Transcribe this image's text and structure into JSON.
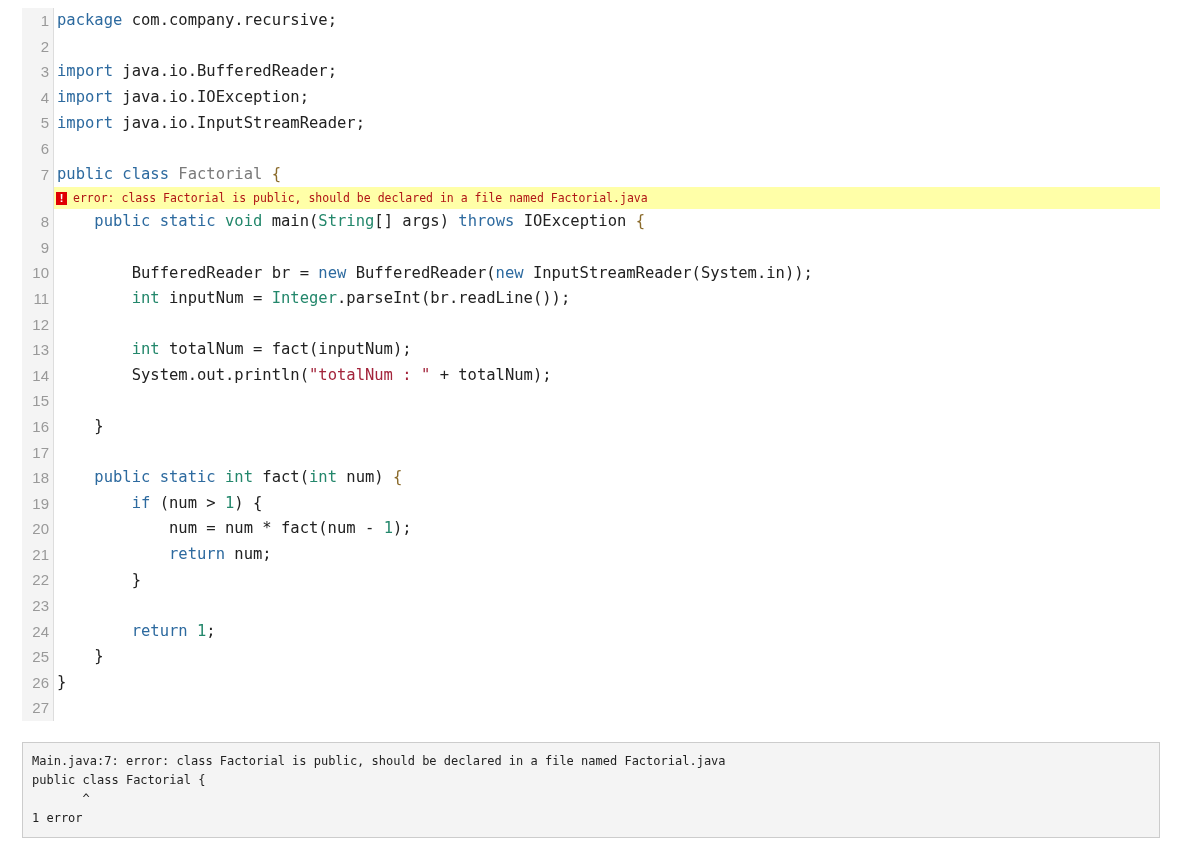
{
  "editor": {
    "lines": [
      {
        "kind": "code",
        "number": "1",
        "tokens": [
          {
            "kind": "keyword",
            "text": "package"
          },
          {
            "kind": "plain",
            "text": " com.company.recursive;"
          }
        ]
      },
      {
        "kind": "code",
        "number": "2"
      },
      {
        "kind": "code",
        "number": "3",
        "tokens": [
          {
            "kind": "keyword",
            "text": "import"
          },
          {
            "kind": "plain",
            "text": " java.io.BufferedReader;"
          }
        ]
      },
      {
        "kind": "code",
        "number": "4",
        "tokens": [
          {
            "kind": "keyword",
            "text": "import"
          },
          {
            "kind": "plain",
            "text": " java.io.IOException;"
          }
        ]
      },
      {
        "kind": "code",
        "number": "5",
        "tokens": [
          {
            "kind": "keyword",
            "text": "import"
          },
          {
            "kind": "plain",
            "text": " java.io.InputStreamReader;"
          }
        ]
      },
      {
        "kind": "code",
        "number": "6"
      },
      {
        "kind": "code",
        "number": "7",
        "tokens": [
          {
            "kind": "keyword",
            "text": "public class "
          },
          {
            "kind": "classname",
            "text": "Factorial "
          },
          {
            "kind": "brace",
            "text": "{"
          }
        ]
      },
      {
        "kind": "error",
        "icon": "!",
        "text": "error: class Factorial is public, should be declared in a file named Factorial.java"
      },
      {
        "kind": "code",
        "number": "8",
        "tokens": [
          {
            "kind": "keyword",
            "text": "    public static "
          },
          {
            "kind": "type",
            "text": "void"
          },
          {
            "kind": "plain",
            "text": " main("
          },
          {
            "kind": "type",
            "text": "String"
          },
          {
            "kind": "plain",
            "text": "[] args) "
          },
          {
            "kind": "keyword",
            "text": "throws"
          },
          {
            "kind": "plain",
            "text": " IOException "
          },
          {
            "kind": "brace",
            "text": "{"
          }
        ]
      },
      {
        "kind": "code",
        "number": "9"
      },
      {
        "kind": "code",
        "number": "10",
        "tokens": [
          {
            "kind": "plain",
            "text": "        BufferedReader br = "
          },
          {
            "kind": "keyword",
            "text": "new"
          },
          {
            "kind": "plain",
            "text": " BufferedReader("
          },
          {
            "kind": "keyword",
            "text": "new"
          },
          {
            "kind": "plain",
            "text": " InputStreamReader(System.in));"
          }
        ]
      },
      {
        "kind": "code",
        "number": "11",
        "tokens": [
          {
            "kind": "type",
            "text": "        int"
          },
          {
            "kind": "plain",
            "text": " inputNum = "
          },
          {
            "kind": "type",
            "text": "Integer"
          },
          {
            "kind": "plain",
            "text": ".parseInt(br.readLine());"
          }
        ]
      },
      {
        "kind": "code",
        "number": "12"
      },
      {
        "kind": "code",
        "number": "13",
        "tokens": [
          {
            "kind": "type",
            "text": "        int"
          },
          {
            "kind": "plain",
            "text": " totalNum = fact(inputNum);"
          }
        ]
      },
      {
        "kind": "code",
        "number": "14",
        "tokens": [
          {
            "kind": "plain",
            "text": "        System.out.println("
          },
          {
            "kind": "string",
            "text": "\"totalNum : \""
          },
          {
            "kind": "plain",
            "text": " + totalNum);"
          }
        ]
      },
      {
        "kind": "code",
        "number": "15"
      },
      {
        "kind": "code",
        "number": "16",
        "tokens": [
          {
            "kind": "plain",
            "text": "    }"
          }
        ]
      },
      {
        "kind": "code",
        "number": "17"
      },
      {
        "kind": "code",
        "number": "18",
        "tokens": [
          {
            "kind": "keyword",
            "text": "    public static "
          },
          {
            "kind": "type",
            "text": "int"
          },
          {
            "kind": "plain",
            "text": " fact("
          },
          {
            "kind": "type",
            "text": "int"
          },
          {
            "kind": "plain",
            "text": " num) "
          },
          {
            "kind": "brace",
            "text": "{"
          }
        ]
      },
      {
        "kind": "code",
        "number": "19",
        "tokens": [
          {
            "kind": "keyword",
            "text": "        if"
          },
          {
            "kind": "plain",
            "text": " (num > "
          },
          {
            "kind": "number",
            "text": "1"
          },
          {
            "kind": "plain",
            "text": ") {"
          }
        ]
      },
      {
        "kind": "code",
        "number": "20",
        "tokens": [
          {
            "kind": "plain",
            "text": "            num = num * fact(num - "
          },
          {
            "kind": "number",
            "text": "1"
          },
          {
            "kind": "plain",
            "text": ");"
          }
        ]
      },
      {
        "kind": "code",
        "number": "21",
        "tokens": [
          {
            "kind": "keyword",
            "text": "            return"
          },
          {
            "kind": "plain",
            "text": " num;"
          }
        ]
      },
      {
        "kind": "code",
        "number": "22",
        "tokens": [
          {
            "kind": "plain",
            "text": "        }"
          }
        ]
      },
      {
        "kind": "code",
        "number": "23"
      },
      {
        "kind": "code",
        "number": "24",
        "tokens": [
          {
            "kind": "keyword",
            "text": "        return "
          },
          {
            "kind": "number",
            "text": "1"
          },
          {
            "kind": "plain",
            "text": ";"
          }
        ]
      },
      {
        "kind": "code",
        "number": "25",
        "tokens": [
          {
            "kind": "plain",
            "text": "    }"
          }
        ]
      },
      {
        "kind": "code",
        "number": "26",
        "tokens": [
          {
            "kind": "plain",
            "text": "}"
          }
        ]
      },
      {
        "kind": "code",
        "number": "27"
      }
    ]
  },
  "output": {
    "lines": [
      "Main.java:7: error: class Factorial is public, should be declared in a file named Factorial.java",
      "public class Factorial {",
      "       ^",
      "1 error"
    ]
  }
}
